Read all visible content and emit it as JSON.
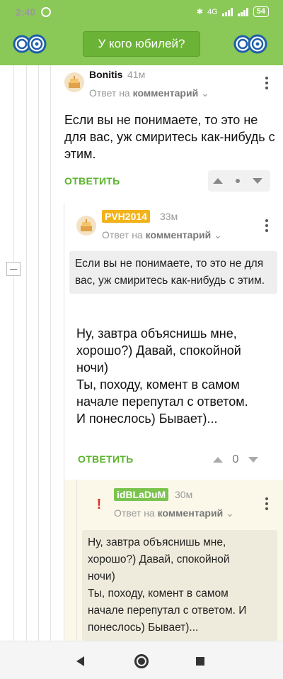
{
  "status_bar": {
    "time": "2:40",
    "network": "4G",
    "battery": "54"
  },
  "header": {
    "button_label": "У кого юбилей?",
    "colors": {
      "bar": "#8ac858",
      "button": "#6bb336",
      "logo": "#1e5fa8"
    },
    "logo_icon": "anniversary-80-logo"
  },
  "comments": [
    {
      "username": "Bonitis",
      "time": "41м",
      "reply_prefix": "Ответ на",
      "reply_target": "комментарий",
      "text": "Если вы не понимаете, то это не для вас, уж смиритесь как-нибудь с этим.",
      "answer_label": "ОТВЕТИТЬ",
      "vote_count": ""
    },
    {
      "username": "PVH2014",
      "badge_color": "#f2b21a",
      "time": "33м",
      "reply_prefix": "Ответ на",
      "reply_target": "комментарий",
      "quote": "Если вы не понимаете, то это не для вас, уж смиритесь как-нибудь с этим.",
      "text_lines": [
        "Ну, завтра объяснишь мне,",
        "хорошо?) Давай, спокойной",
        "ночи)",
        "Ты, походу, комент в самом",
        "начале перепутал с ответом.",
        "И понеслось) Бывает)..."
      ],
      "answer_label": "ОТВЕТИТЬ",
      "vote_count": "0"
    },
    {
      "username": "idBLaDuM",
      "badge_color": "#7cc34e",
      "time": "30м",
      "reply_prefix": "Ответ на",
      "reply_target": "комментарий",
      "quote_lines": [
        "Ну, завтра объяснишь мне,",
        "хорошо?) Давай, спокойной",
        "ночи)",
        "Ты, походу, комент в самом",
        "начале перепутал с ответом. И",
        "понеслось) Бывает)..."
      ]
    }
  ]
}
